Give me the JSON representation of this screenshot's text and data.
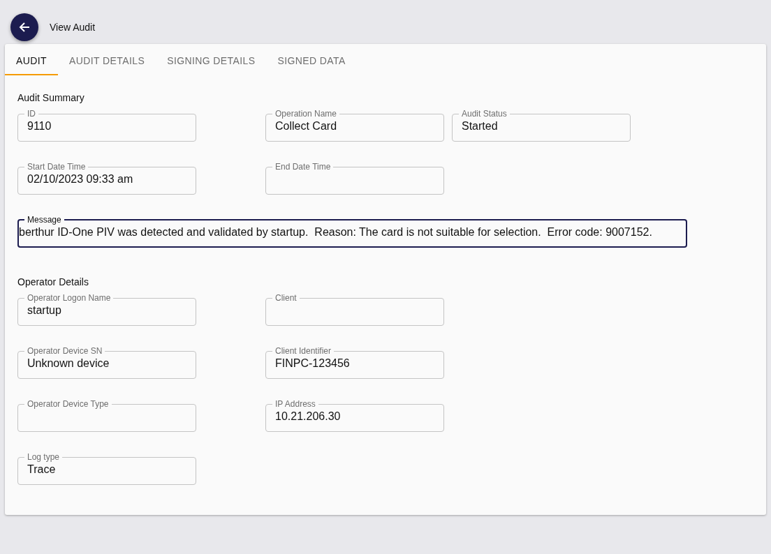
{
  "header": {
    "title": "View Audit"
  },
  "tabs": [
    {
      "label": "AUDIT",
      "selected": true
    },
    {
      "label": "AUDIT DETAILS",
      "selected": false
    },
    {
      "label": "SIGNING DETAILS",
      "selected": false
    },
    {
      "label": "SIGNED DATA",
      "selected": false
    }
  ],
  "sections": [
    {
      "title": "Audit Summary",
      "rows": [
        [
          {
            "label": "ID",
            "value": "9110",
            "focused": false
          },
          {
            "label": "Operation Name",
            "value": "Collect Card",
            "focused": false
          },
          {
            "label": "Audit Status",
            "value": "Started",
            "focused": false
          }
        ],
        [
          {
            "label": "Start Date Time",
            "value": "02/10/2023 09:33 am",
            "focused": false
          },
          {
            "label": "End Date Time",
            "focused": false
          }
        ],
        [
          {
            "label": "Message",
            "kind": "wide",
            "value": "berthur ID-One PIV was detected and validated by startup.  Reason: The card is not suitable for selection.  Error code: 9007152.",
            "focused": true
          }
        ]
      ]
    },
    {
      "title": "Operator Details",
      "rows": [
        [
          {
            "label": "Operator Logon Name",
            "value": "startup",
            "focused": false
          },
          {
            "label": "Client",
            "focused": false
          }
        ],
        [
          {
            "label": "Operator Device SN",
            "value": "Unknown device",
            "focused": false
          },
          {
            "label": "Client Identifier",
            "value": "FINPC-123456",
            "focused": false
          }
        ],
        [
          {
            "label": "Operator Device Type",
            "focused": false
          },
          {
            "label": "IP Address",
            "value": "10.21.206.30",
            "focused": false
          }
        ],
        [
          {
            "label": "Log type",
            "value": "Trace",
            "focused": false
          }
        ]
      ]
    }
  ]
}
